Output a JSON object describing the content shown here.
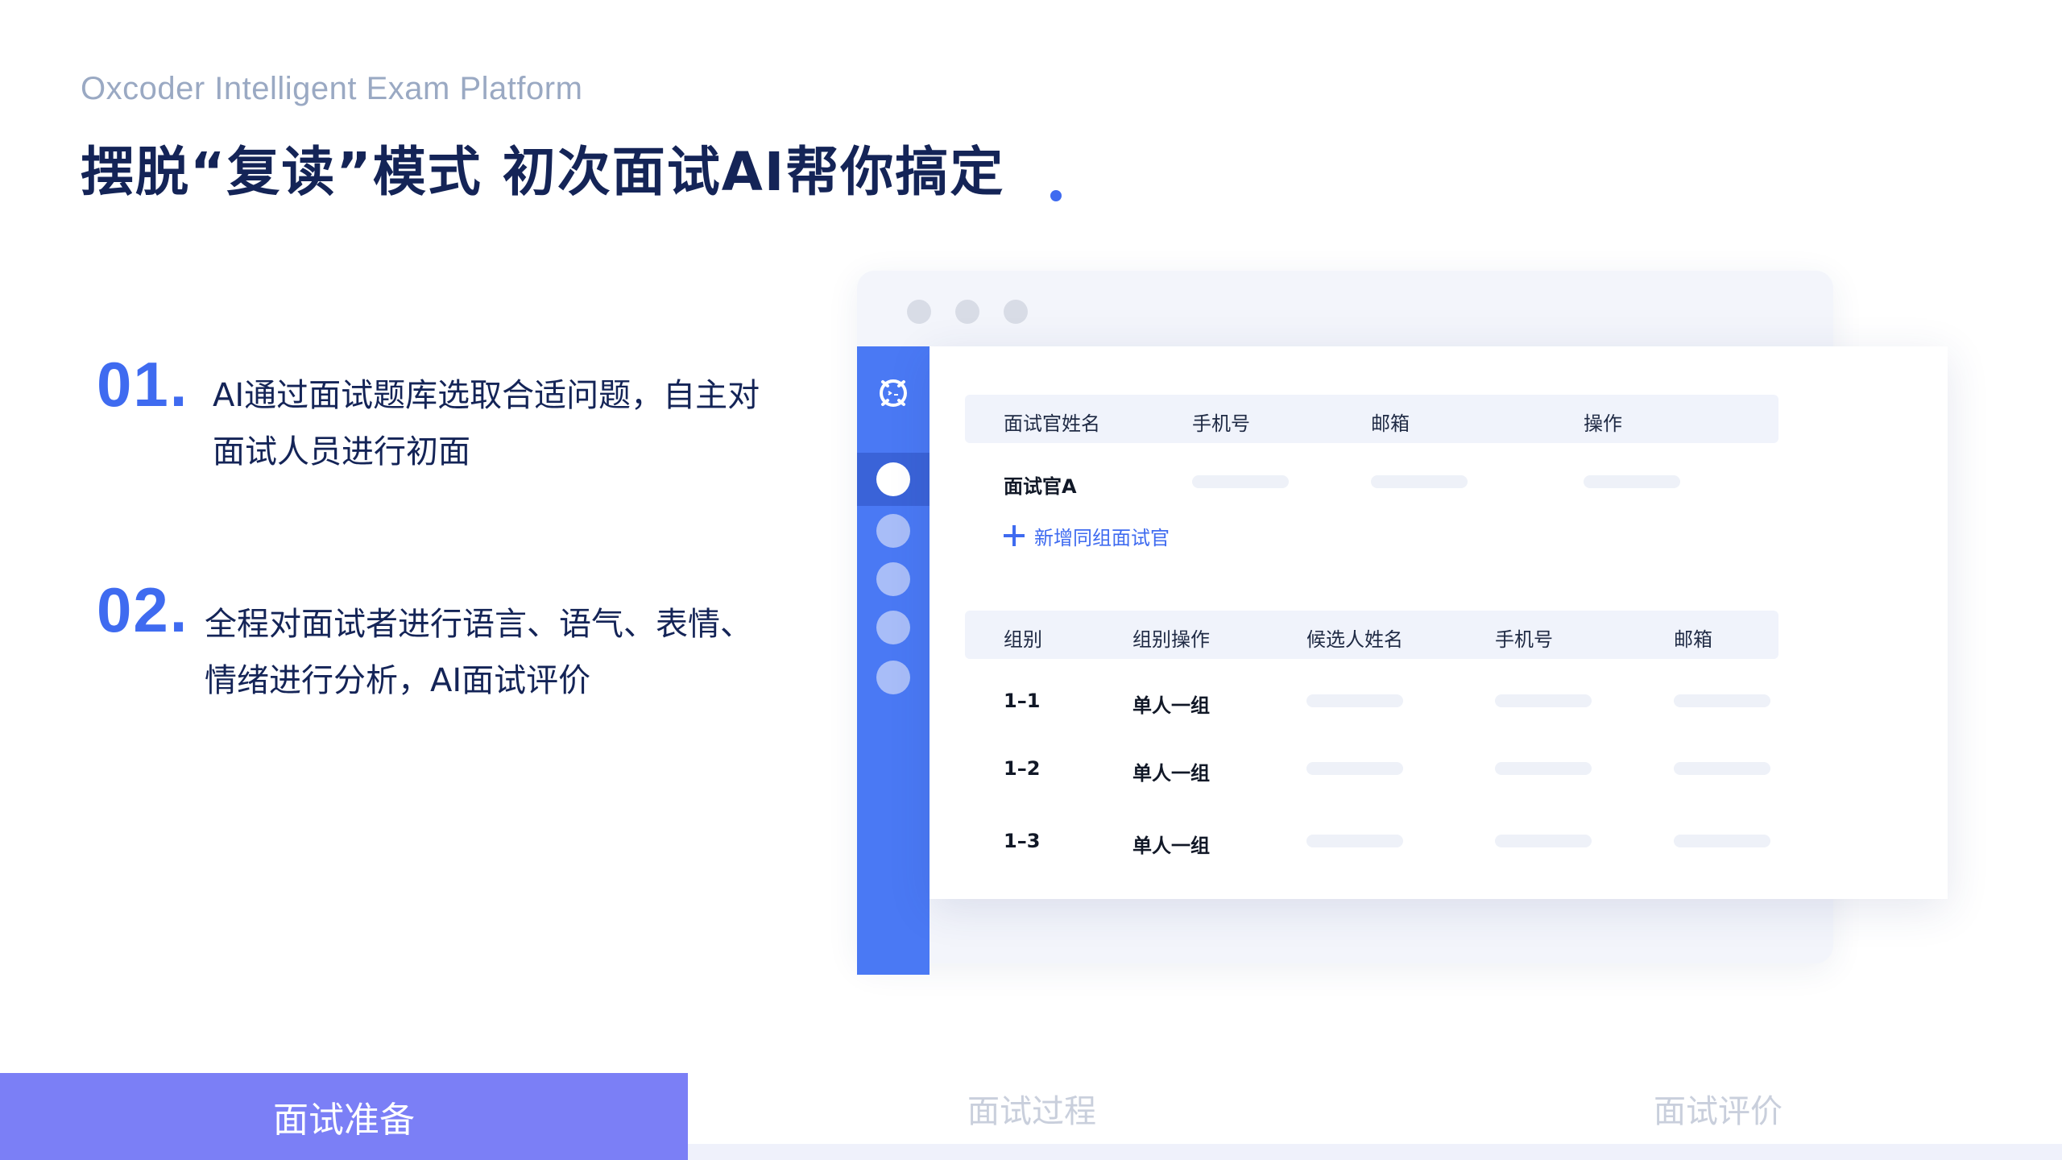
{
  "header": {
    "subtitle": "Oxcoder Intelligent Exam Platform",
    "title": "摆脱“复读”模式  初次面试AI帮你搞定"
  },
  "points": [
    {
      "num": "01.",
      "lines": [
        "AI通过面试题库选取合适问题，自主对",
        "面试人员进行初面"
      ]
    },
    {
      "num": "02.",
      "lines": [
        "全程对面试者进行语言、语气、表情、",
        "情绪进行分析，AI面试评价"
      ]
    }
  ],
  "mock": {
    "interviewer_table": {
      "headers": [
        "面试官姓名",
        "手机号",
        "邮箱",
        "操作"
      ],
      "rows": [
        {
          "name": "面试官A"
        }
      ],
      "add_label": "新增同组面试官"
    },
    "group_table": {
      "headers": [
        "组别",
        "组别操作",
        "候选人姓名",
        "手机号",
        "邮箱"
      ],
      "rows": [
        {
          "group": "1–1",
          "op": "单人一组"
        },
        {
          "group": "1–2",
          "op": "单人一组"
        },
        {
          "group": "1–3",
          "op": "单人一组"
        }
      ]
    }
  },
  "tabs": [
    {
      "label": "面试准备",
      "active": true
    },
    {
      "label": "面试过程",
      "active": false
    },
    {
      "label": "面试评价",
      "active": false
    }
  ],
  "colors": {
    "accent": "#3f6bf0",
    "title": "#142457",
    "sidebar": "#4a79f4",
    "active_tab": "#7b7ff6"
  }
}
